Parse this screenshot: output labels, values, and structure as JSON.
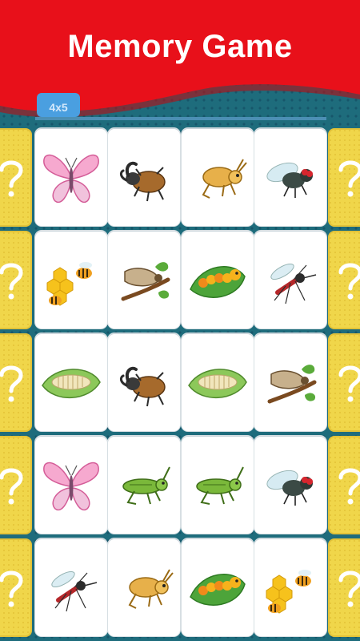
{
  "header": {
    "title": "Memory Game",
    "mode": "4x5"
  },
  "colors": {
    "header_red": "#e8101a",
    "background_teal": "#1e6c7c",
    "side_card_yellow": "#f0d64a",
    "card_white": "#ffffff"
  },
  "board": {
    "columns": 4,
    "rows": 5,
    "cards": [
      [
        "butterfly-icon",
        "rhinoceros-beetle-icon",
        "grasshopper-icon",
        "housefly-icon"
      ],
      [
        "honeybee-icon",
        "cicada-icon",
        "caterpillar-icon",
        "mosquito-icon"
      ],
      [
        "larva-icon",
        "rhinoceros-beetle-icon",
        "larva-icon",
        "cicada-icon"
      ],
      [
        "butterfly-icon",
        "green-grasshopper-icon",
        "green-grasshopper-icon",
        "housefly-icon"
      ],
      [
        "mosquito-icon",
        "grasshopper-icon",
        "caterpillar-icon",
        "honeybee-icon"
      ]
    ],
    "side_cards": [
      "question-mark-icon",
      "question-mark-icon",
      "question-mark-icon",
      "question-mark-icon",
      "question-mark-icon"
    ]
  }
}
